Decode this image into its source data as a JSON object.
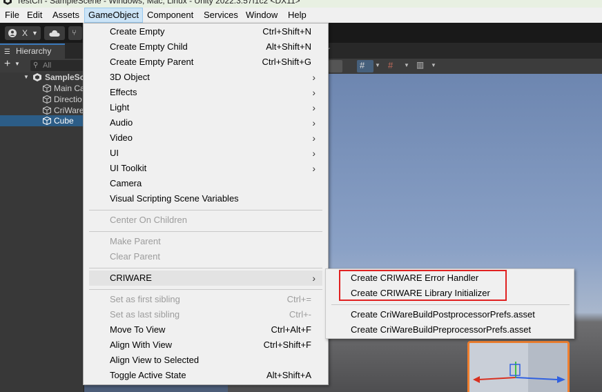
{
  "window": {
    "title": "TestCri - SampleScene - Windows, Mac, Linux - Unity 2022.3.57f1c2 <DX11>"
  },
  "menubar": {
    "items": [
      "File",
      "Edit",
      "Assets",
      "GameObject",
      "Component",
      "Services",
      "Window",
      "Help"
    ],
    "active": "GameObject"
  },
  "toolbar": {
    "account_label": "X"
  },
  "hierarchy": {
    "tab_label": "Hierarchy",
    "search_placeholder": "All",
    "scene_name": "SampleSc",
    "items": [
      "Main Ca",
      "Directio",
      "CriWare",
      "Cube"
    ],
    "selected": "Cube"
  },
  "scene": {
    "tab_fragment": "r"
  },
  "gameobject_menu": {
    "items": [
      {
        "label": "Create Empty",
        "shortcut": "Ctrl+Shift+N"
      },
      {
        "label": "Create Empty Child",
        "shortcut": "Alt+Shift+N"
      },
      {
        "label": "Create Empty Parent",
        "shortcut": "Ctrl+Shift+G"
      },
      {
        "label": "3D Object",
        "shortcut": ""
      },
      {
        "label": "Effects",
        "shortcut": ""
      },
      {
        "label": "Light",
        "shortcut": ""
      },
      {
        "label": "Audio",
        "shortcut": ""
      },
      {
        "label": "Video",
        "shortcut": ""
      },
      {
        "label": "UI",
        "shortcut": ""
      },
      {
        "label": "UI Toolkit",
        "shortcut": ""
      },
      {
        "label": "Camera",
        "shortcut": ""
      },
      {
        "label": "Visual Scripting Scene Variables",
        "shortcut": ""
      },
      {
        "label": "Center On Children",
        "shortcut": ""
      },
      {
        "label": "Make Parent",
        "shortcut": ""
      },
      {
        "label": "Clear Parent",
        "shortcut": ""
      },
      {
        "label": "CRIWARE",
        "shortcut": ""
      },
      {
        "label": "Set as first sibling",
        "shortcut": "Ctrl+="
      },
      {
        "label": "Set as last sibling",
        "shortcut": "Ctrl+-"
      },
      {
        "label": "Move To View",
        "shortcut": "Ctrl+Alt+F"
      },
      {
        "label": "Align With View",
        "shortcut": "Ctrl+Shift+F"
      },
      {
        "label": "Align View to Selected",
        "shortcut": ""
      },
      {
        "label": "Toggle Active State",
        "shortcut": "Alt+Shift+A"
      }
    ]
  },
  "criware_submenu": {
    "items": [
      "Create CRIWARE Error Handler",
      "Create CRIWARE Library Initializer",
      "Create CriWareBuildPostprocessorPrefs.asset",
      "Create CriWareBuildPreprocessorPrefs.asset"
    ]
  },
  "colors": {
    "highlight_box": "#e02020",
    "selection": "#2c5d87",
    "gizmo_outline": "#f08030"
  }
}
